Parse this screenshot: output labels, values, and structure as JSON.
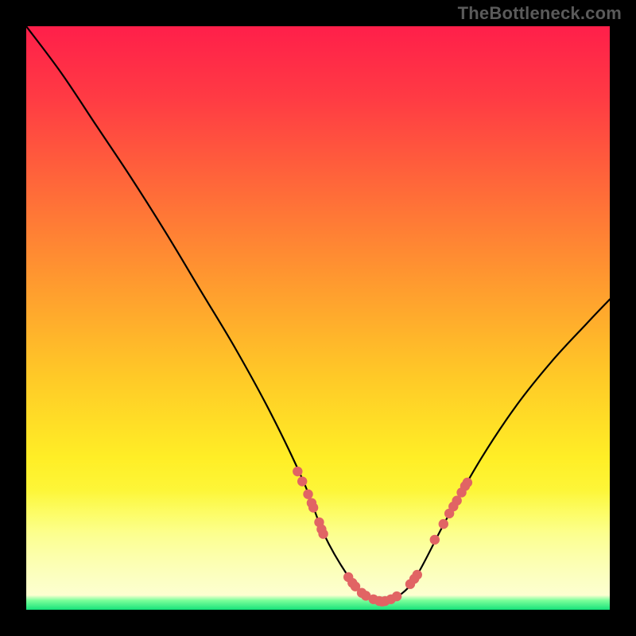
{
  "watermark": "TheBottleneck.com",
  "chart_data": {
    "type": "line",
    "title": "",
    "xlabel": "",
    "ylabel": "",
    "xlim": [
      0,
      100
    ],
    "ylim": [
      0,
      100
    ],
    "series": [
      {
        "name": "bottleneck-curve",
        "x": [
          0,
          6,
          12,
          18,
          24,
          30,
          36,
          42,
          47.5,
          51,
          55,
          58,
          61,
          64,
          67,
          72,
          78,
          84,
          90,
          96,
          100
        ],
        "y": [
          100,
          92,
          83,
          74,
          64.5,
          54.5,
          44.5,
          33.5,
          22,
          13,
          6,
          2.5,
          1.4,
          2.5,
          6,
          15.5,
          26,
          35,
          42.5,
          49,
          53.2
        ]
      }
    ],
    "threshold_band": {
      "y_start": 20.5,
      "y_end": 0
    },
    "green_band": {
      "y_start": 2.5,
      "y_end": 0
    },
    "markers": {
      "name": "highlighted-points",
      "color": "#e16464",
      "points": [
        {
          "x": 46.5,
          "y": 23.7
        },
        {
          "x": 47.3,
          "y": 22.0
        },
        {
          "x": 48.3,
          "y": 19.8
        },
        {
          "x": 48.9,
          "y": 18.3
        },
        {
          "x": 49.2,
          "y": 17.5
        },
        {
          "x": 50.2,
          "y": 15.0
        },
        {
          "x": 50.6,
          "y": 13.8
        },
        {
          "x": 50.9,
          "y": 13.0
        },
        {
          "x": 55.2,
          "y": 5.6
        },
        {
          "x": 55.9,
          "y": 4.6
        },
        {
          "x": 56.4,
          "y": 4.0
        },
        {
          "x": 57.5,
          "y": 2.9
        },
        {
          "x": 58.2,
          "y": 2.4
        },
        {
          "x": 59.5,
          "y": 1.8
        },
        {
          "x": 60.5,
          "y": 1.5
        },
        {
          "x": 61.0,
          "y": 1.4
        },
        {
          "x": 61.5,
          "y": 1.5
        },
        {
          "x": 62.5,
          "y": 1.8
        },
        {
          "x": 63.5,
          "y": 2.3
        },
        {
          "x": 65.8,
          "y": 4.4
        },
        {
          "x": 66.5,
          "y": 5.3
        },
        {
          "x": 67.0,
          "y": 6.0
        },
        {
          "x": 70.0,
          "y": 12.0
        },
        {
          "x": 71.5,
          "y": 14.7
        },
        {
          "x": 72.5,
          "y": 16.5
        },
        {
          "x": 73.2,
          "y": 17.7
        },
        {
          "x": 73.8,
          "y": 18.7
        },
        {
          "x": 74.6,
          "y": 20.1
        },
        {
          "x": 75.2,
          "y": 21.2
        },
        {
          "x": 75.6,
          "y": 21.8
        }
      ]
    }
  }
}
